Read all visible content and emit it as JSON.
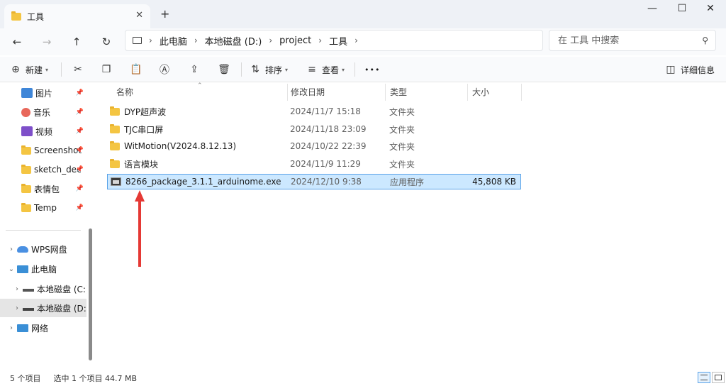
{
  "window": {
    "tab_title": "工具",
    "tab_close": "✕",
    "new_tab": "+",
    "minimize": "—",
    "maximize": "☐",
    "close": "✕"
  },
  "nav": {
    "back": "←",
    "forward": "→",
    "up": "↑",
    "refresh": "↻"
  },
  "breadcrumb": [
    "此电脑",
    "本地磁盘 (D:)",
    "project",
    "工具"
  ],
  "search": {
    "placeholder": "在 工具 中搜索"
  },
  "toolbar": {
    "new_label": "新建",
    "sort_label": "排序",
    "view_label": "查看",
    "more_label": "•••",
    "details_label": "详细信息"
  },
  "sidebar": {
    "quick_access": [
      {
        "label": "图片",
        "icon": "pictures-icon",
        "color": "#3f86d8"
      },
      {
        "label": "音乐",
        "icon": "music-icon",
        "color": "#e8675a"
      },
      {
        "label": "视频",
        "icon": "videos-icon",
        "color": "#7e4fc9"
      },
      {
        "label": "Screenshot",
        "icon": "folder-icon"
      },
      {
        "label": "sketch_dec",
        "icon": "folder-icon"
      },
      {
        "label": "表情包",
        "icon": "folder-icon"
      },
      {
        "label": "Temp",
        "icon": "folder-icon"
      }
    ],
    "tree": [
      {
        "label": "WPS网盘",
        "icon": "cloud-icon",
        "expanded": false
      },
      {
        "label": "此电脑",
        "icon": "this-pc-icon",
        "expanded": true
      },
      {
        "label": "本地磁盘 (C:)",
        "icon": "drive-c-icon",
        "expanded": false
      },
      {
        "label": "本地磁盘 (D:)",
        "icon": "drive-d-icon",
        "expanded": false,
        "selected": true
      },
      {
        "label": "网络",
        "icon": "network-icon",
        "expanded": false
      }
    ]
  },
  "columns": {
    "name": "名称",
    "date": "修改日期",
    "type": "类型",
    "size": "大小"
  },
  "files": [
    {
      "name": "DYP超声波",
      "date": "2024/11/7 15:18",
      "type": "文件夹",
      "size": "",
      "kind": "folder"
    },
    {
      "name": "TJC串口屏",
      "date": "2024/11/18 23:09",
      "type": "文件夹",
      "size": "",
      "kind": "folder"
    },
    {
      "name": "WitMotion(V2024.8.12.13)",
      "date": "2024/10/22 22:39",
      "type": "文件夹",
      "size": "",
      "kind": "folder"
    },
    {
      "name": "语言模块",
      "date": "2024/11/9 11:29",
      "type": "文件夹",
      "size": "",
      "kind": "folder"
    },
    {
      "name": "8266_package_3.1.1_arduinome.exe",
      "date": "2024/12/10 9:38",
      "type": "应用程序",
      "size": "45,808 KB",
      "kind": "exe",
      "selected": true
    }
  ],
  "status": {
    "item_count": "5 个项目",
    "selection": "选中 1 个项目  44.7 MB"
  },
  "colors": {
    "selection_bg": "#cce8ff",
    "selection_border": "#5aa3e8",
    "annotation_arrow": "#e53935",
    "folder": "#f4c542"
  }
}
